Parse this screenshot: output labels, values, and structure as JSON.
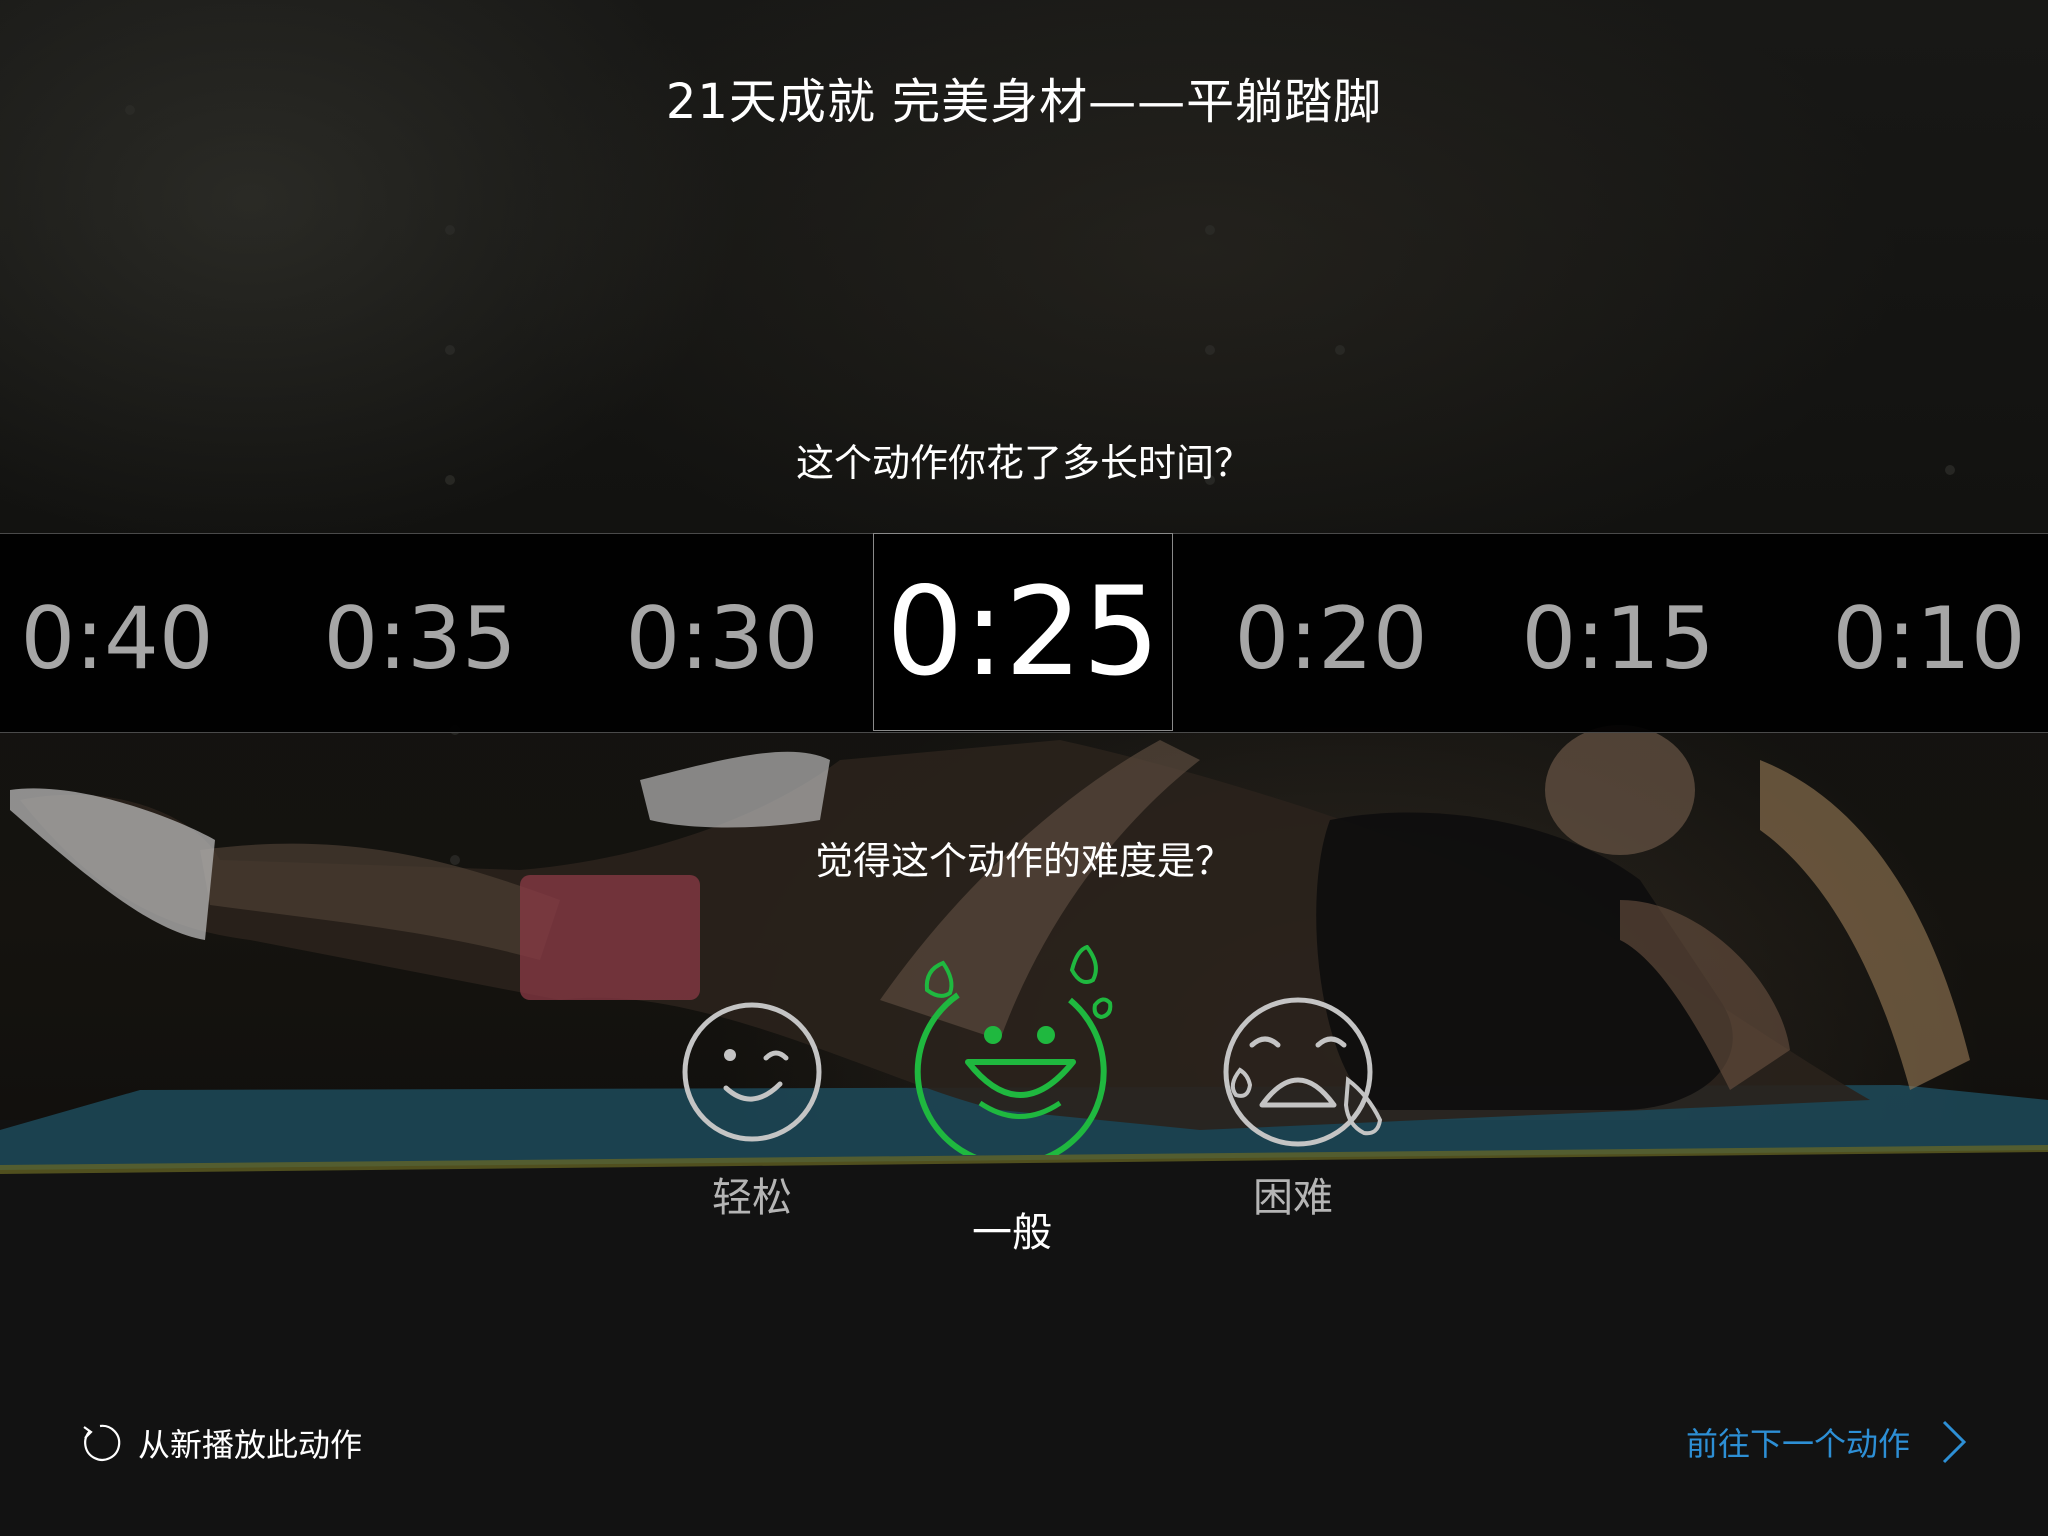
{
  "header": {
    "title": "21天成就 完美身材——平躺踏脚"
  },
  "time_picker": {
    "question": "这个动作你花了多长时间？",
    "options": [
      "0:40",
      "0:35",
      "0:30",
      "0:25",
      "0:20",
      "0:15",
      "0:10"
    ],
    "selected": "0:25"
  },
  "difficulty": {
    "question": "觉得这个动作的难度是？",
    "options": [
      {
        "label": "轻松",
        "icon": "wink-face-icon"
      },
      {
        "label": "一般",
        "icon": "laughing-sweat-face-icon"
      },
      {
        "label": "困难",
        "icon": "crying-face-icon"
      }
    ],
    "selected": "一般",
    "accent_color": "#1fb83f",
    "inactive_color": "#c4c4c4"
  },
  "footer": {
    "replay_label": "从新播放此动作",
    "replay_icon": "replay-icon",
    "next_label": "前往下一个动作",
    "next_icon": "chevron-right-icon",
    "next_color": "#2d8fd5"
  }
}
